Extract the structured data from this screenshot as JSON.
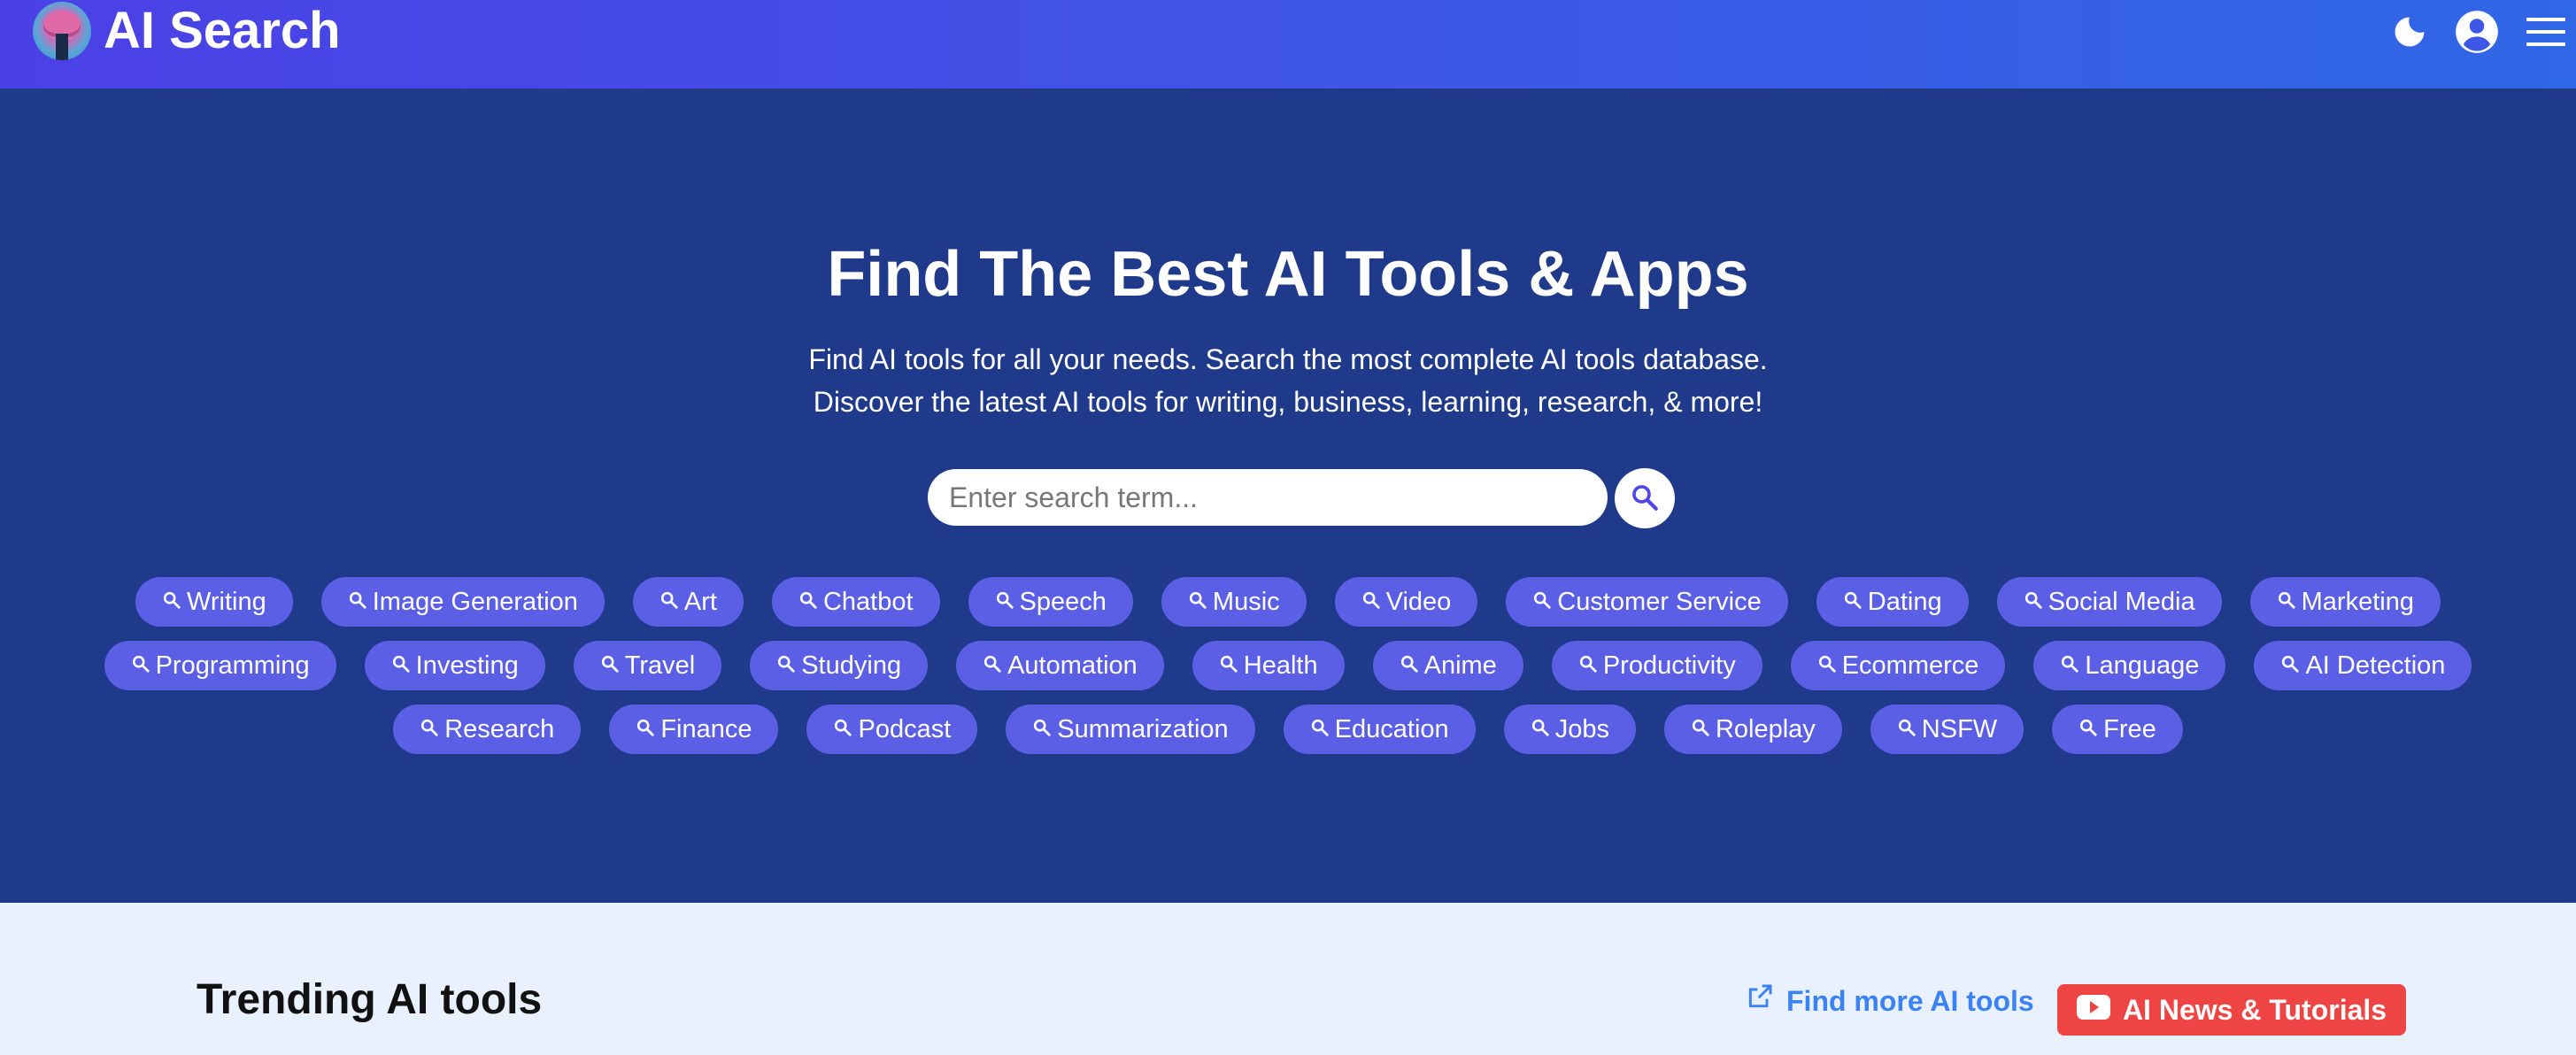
{
  "header": {
    "title": "AI Search",
    "icons": [
      "moon-icon",
      "account-icon",
      "menu-icon"
    ]
  },
  "hero": {
    "title": "Find The Best AI Tools & Apps",
    "subtitle_line1": "Find AI tools for all your needs. Search the most complete AI tools database.",
    "subtitle_line2": "Discover the latest AI tools for writing, business, learning, research, & more!",
    "search": {
      "placeholder": "Enter search term...",
      "value": ""
    },
    "tag_rows": [
      [
        "Writing",
        "Image Generation",
        "Art",
        "Chatbot",
        "Speech",
        "Music",
        "Video",
        "Customer Service",
        "Dating",
        "Social Media",
        "Marketing"
      ],
      [
        "Programming",
        "Investing",
        "Travel",
        "Studying",
        "Automation",
        "Health",
        "Anime",
        "Productivity",
        "Ecommerce",
        "Language",
        "AI Detection"
      ],
      [
        "Research",
        "Finance",
        "Podcast",
        "Summarization",
        "Education",
        "Jobs",
        "Roleplay",
        "NSFW",
        "Free"
      ]
    ]
  },
  "trending": {
    "title": "Trending AI tools",
    "find_more": "Find more AI tools",
    "news": "AI News & Tutorials"
  },
  "colors": {
    "header_gradient_start": "#4b40e6",
    "header_gradient_end": "#2f67e6",
    "hero_background": "#1f3a8a",
    "tag_background": "#5b5fe6",
    "link_blue": "#3b82f6",
    "news_red": "#ef4444",
    "lower_background": "#e8f1fd"
  }
}
